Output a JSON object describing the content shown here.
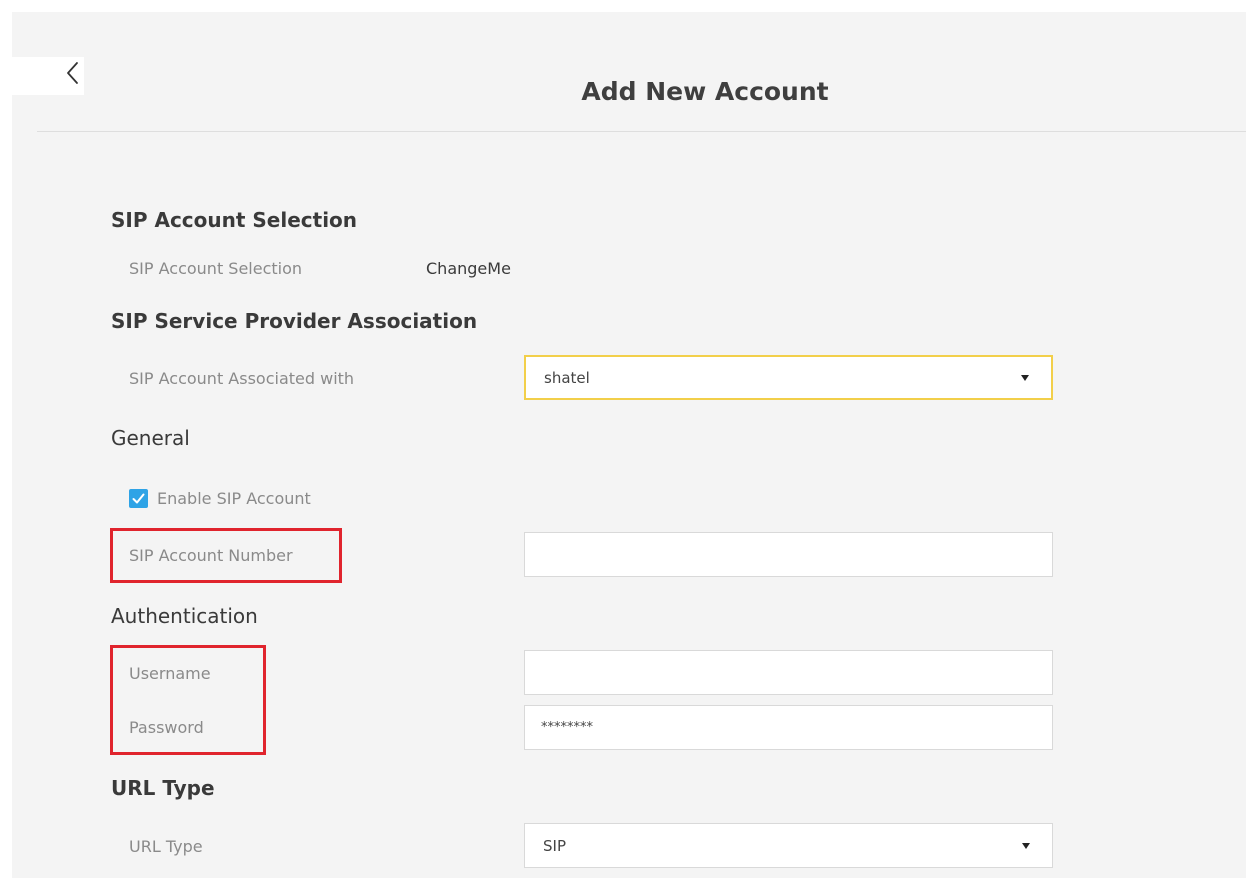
{
  "header": {
    "title": "Add New Account",
    "back_icon": "chevron-left-icon"
  },
  "sections": {
    "sip_account_selection": {
      "heading": "SIP Account Selection",
      "label": "SIP Account Selection",
      "value": "ChangeMe"
    },
    "provider_association": {
      "heading": "SIP Service Provider Association",
      "label": "SIP Account Associated with",
      "selected": "shatel"
    },
    "general": {
      "heading": "General",
      "enable_label": "Enable SIP Account",
      "enable_checked": true,
      "number_label": "SIP Account Number",
      "number_value": ""
    },
    "authentication": {
      "heading": "Authentication",
      "username_label": "Username",
      "username_value": "",
      "password_label": "Password",
      "password_value": "********"
    },
    "url_type": {
      "heading": "URL Type",
      "label": "URL Type",
      "selected": "SIP"
    }
  },
  "colors": {
    "focus_border": "#f2cf4a",
    "checkbox_fill": "#2ea3e6",
    "highlight_annotation": "#e0242d"
  }
}
